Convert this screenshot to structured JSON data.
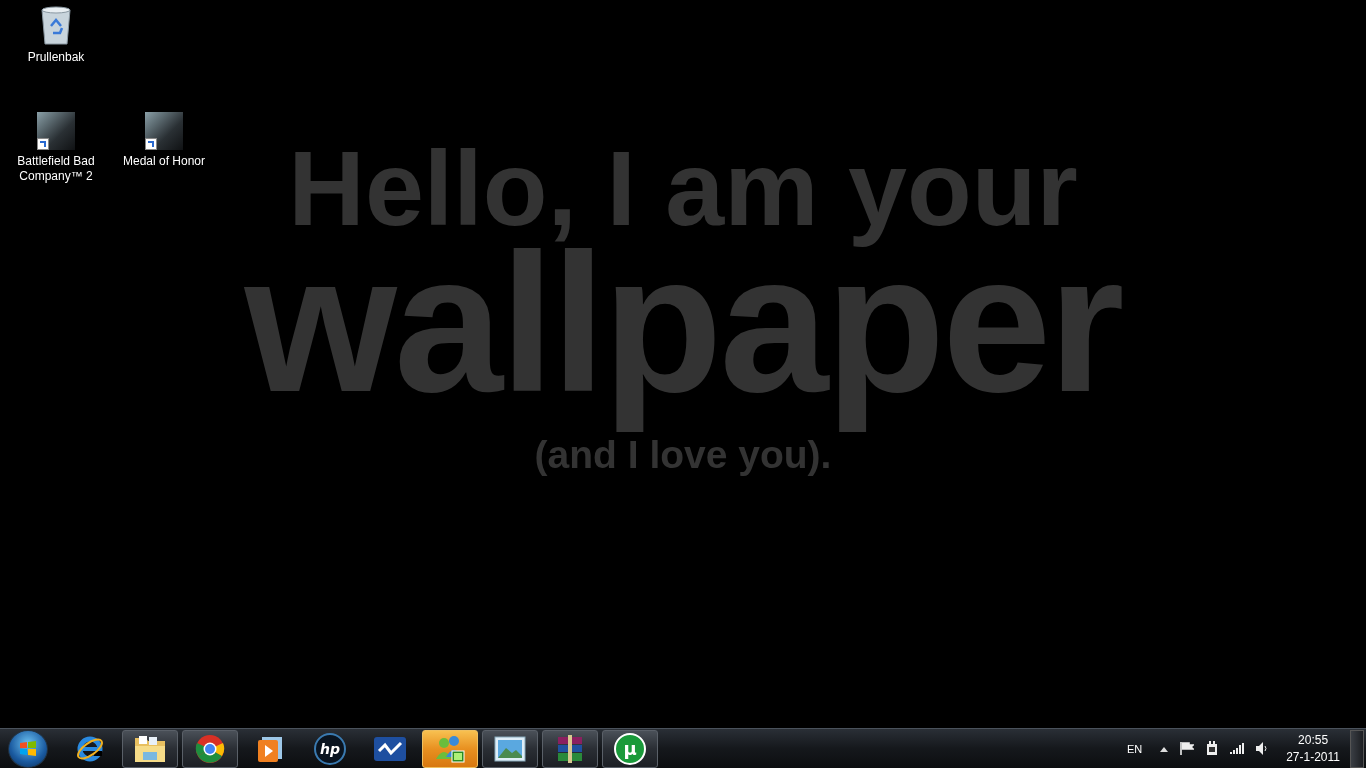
{
  "wallpaper": {
    "lines": [
      {
        "kind": "top",
        "text": "Hello, I am your"
      },
      {
        "kind": "big",
        "text": "wallpaper"
      },
      {
        "kind": "small",
        "text": "(and I love you)."
      }
    ]
  },
  "desktop_icons": [
    {
      "kind": "bin",
      "label": "Prullenbak"
    },
    {
      "kind": "game",
      "label": "Battlefield Bad Company™ 2"
    },
    {
      "kind": "game",
      "label": "Medal of Honor"
    }
  ],
  "taskbar": {
    "items": [
      {
        "kind": "ie",
        "running": false,
        "flashing": false
      },
      {
        "kind": "folder",
        "running": true,
        "flashing": false
      },
      {
        "kind": "chrome",
        "running": true,
        "flashing": false
      },
      {
        "kind": "player",
        "running": false,
        "flashing": false
      },
      {
        "kind": "hp",
        "label": "hp",
        "running": false,
        "flashing": false
      },
      {
        "kind": "chart",
        "running": false,
        "flashing": false
      },
      {
        "kind": "messenger",
        "running": true,
        "flashing": true
      },
      {
        "kind": "photo",
        "running": true,
        "flashing": false
      },
      {
        "kind": "archive",
        "running": true,
        "flashing": false
      },
      {
        "kind": "torrent",
        "label": "µ",
        "running": true,
        "flashing": false
      }
    ],
    "language": "EN",
    "clock": {
      "time": "20:55",
      "date": "27-1-2011"
    }
  }
}
